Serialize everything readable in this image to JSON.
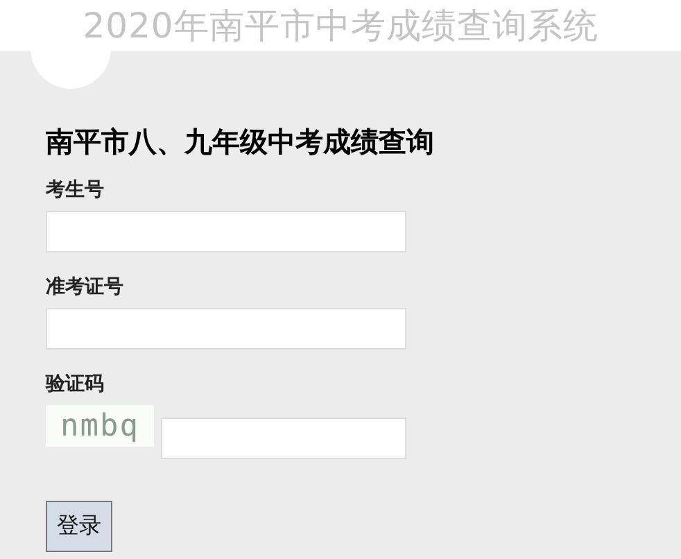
{
  "banner": {
    "title": "2020年南平市中考成绩查询系统"
  },
  "form": {
    "heading": "南平市八、九年级中考成绩查询",
    "fields": [
      {
        "label": "考生号",
        "kind": "text"
      },
      {
        "label": "准考证号",
        "kind": "text"
      },
      {
        "label": "验证码",
        "kind": "captcha",
        "captcha": "nmbq"
      }
    ],
    "submit": "登录"
  }
}
